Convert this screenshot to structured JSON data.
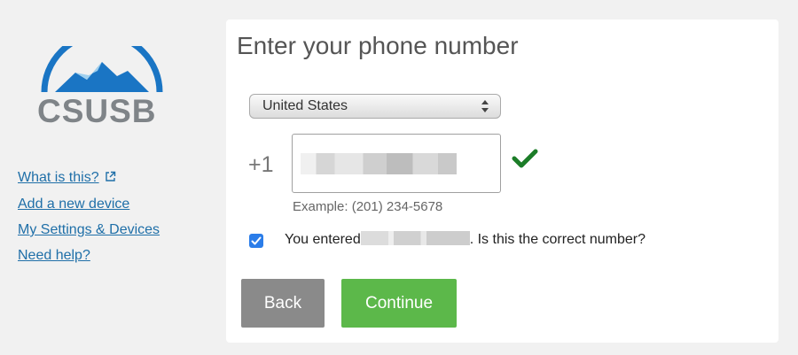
{
  "sidebar": {
    "logo_text": "CSUSB",
    "links": [
      {
        "label": "What is this?",
        "icon": "external-link-icon"
      },
      {
        "label": "Add a new device"
      },
      {
        "label": "My Settings & Devices"
      },
      {
        "label": "Need help?"
      }
    ]
  },
  "main": {
    "title": "Enter your phone number",
    "country_select": {
      "value": "United States"
    },
    "country_code": "+1",
    "phone_input": {
      "value": "",
      "validated": true
    },
    "example": "Example: (201) 234-5678",
    "confirm": {
      "checked": true,
      "prefix": "You entered",
      "suffix": ". Is this the correct number?"
    },
    "buttons": {
      "back": "Back",
      "continue": "Continue"
    }
  },
  "colors": {
    "link": "#1f6fa8",
    "continue_button": "#5cb84a",
    "back_button": "#8a8a8a",
    "check": "#1c7d28",
    "checkbox": "#2b7de9",
    "logo_blue": "#1a75c4"
  }
}
